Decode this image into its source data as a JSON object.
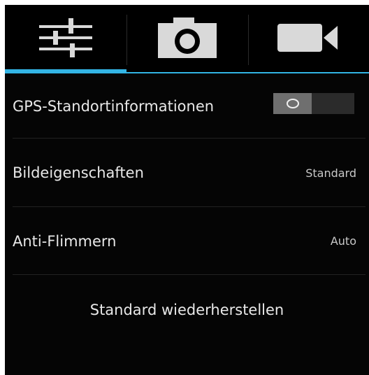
{
  "tabs": [
    {
      "icon": "sliders-icon",
      "selected": true
    },
    {
      "icon": "camera-icon",
      "selected": false
    },
    {
      "icon": "video-camera-icon",
      "selected": false
    }
  ],
  "accent_color": "#33b5e5",
  "settings": {
    "gps": {
      "label": "GPS-Standortinformationen",
      "toggle_on": false
    },
    "image_properties": {
      "label": "Bildeigenschaften",
      "value": "Standard"
    },
    "anti_flicker": {
      "label": "Anti-Flimmern",
      "value": "Auto"
    }
  },
  "reset_label": "Standard wiederherstellen"
}
